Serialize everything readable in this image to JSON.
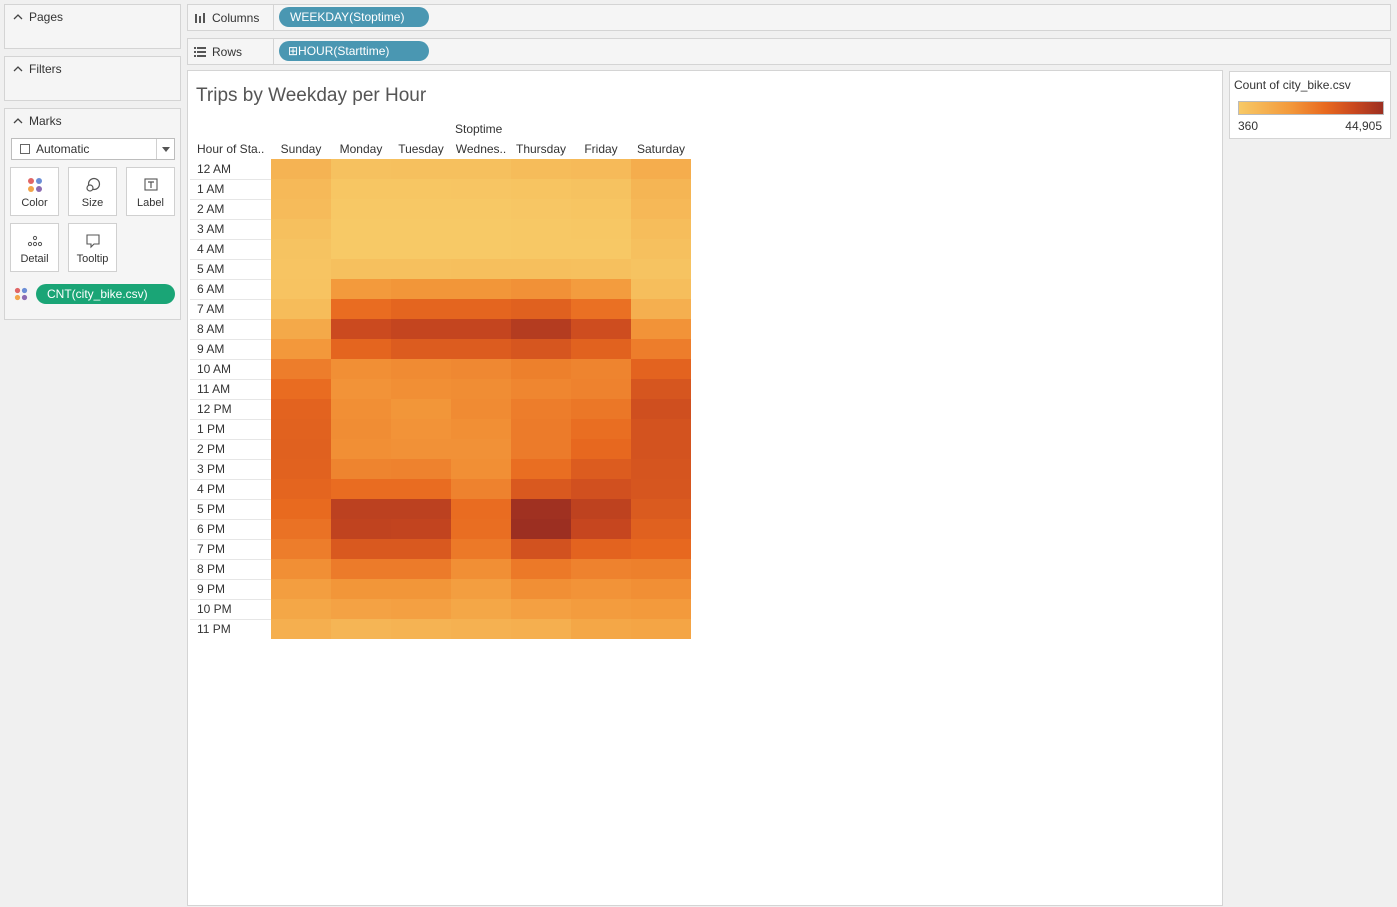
{
  "left_panel": {
    "pages_label": "Pages",
    "filters_label": "Filters",
    "marks_label": "Marks",
    "mark_type": "Automatic",
    "buttons": {
      "color": "Color",
      "size": "Size",
      "label": "Label",
      "detail": "Detail",
      "tooltip": "Tooltip"
    },
    "color_pill": "CNT(city_bike.csv)"
  },
  "shelves": {
    "columns_label": "Columns",
    "columns_pill": "WEEKDAY(Stoptime)",
    "rows_label": "Rows",
    "rows_pill": "⊞HOUR(Starttime)"
  },
  "worksheet": {
    "title": "Trips by Weekday per Hour",
    "column_field": "Stoptime",
    "row_header": "Hour of Sta..",
    "days": [
      "Sunday",
      "Monday",
      "Tuesday",
      "Wednes..",
      "Thursday",
      "Friday",
      "Saturday"
    ],
    "hours": [
      "12 AM",
      "1 AM",
      "2 AM",
      "3 AM",
      "4 AM",
      "5 AM",
      "6 AM",
      "7 AM",
      "8 AM",
      "9 AM",
      "10 AM",
      "11 AM",
      "12 PM",
      "1 PM",
      "2 PM",
      "3 PM",
      "4 PM",
      "5 PM",
      "6 PM",
      "7 PM",
      "8 PM",
      "9 PM",
      "10 PM",
      "11 PM"
    ]
  },
  "legend": {
    "title": "Count of city_bike.csv",
    "min": "360",
    "max": "44,905",
    "colors": [
      "#f7c966",
      "#f39a3c",
      "#e8691f",
      "#c9481f",
      "#9c2f21"
    ]
  },
  "colors": {
    "pill_blue": "#4a97b2",
    "pill_green": "#1aa576"
  },
  "chart_data": {
    "type": "heatmap",
    "title": "Trips by Weekday per Hour",
    "x_field": "Stoptime",
    "y_field": "Hour of Sta..",
    "x": [
      "Sunday",
      "Monday",
      "Tuesday",
      "Wednes..",
      "Thursday",
      "Friday",
      "Saturday"
    ],
    "y": [
      "12 AM",
      "1 AM",
      "2 AM",
      "3 AM",
      "4 AM",
      "5 AM",
      "6 AM",
      "7 AM",
      "8 AM",
      "9 AM",
      "10 AM",
      "11 AM",
      "12 PM",
      "1 PM",
      "2 PM",
      "3 PM",
      "4 PM",
      "5 PM",
      "6 PM",
      "7 PM",
      "8 PM",
      "9 PM",
      "10 PM",
      "11 PM"
    ],
    "color_range": [
      360,
      44905
    ],
    "values": [
      [
        5500,
        2200,
        2400,
        2600,
        3500,
        3800,
        7000
      ],
      [
        4200,
        1100,
        1100,
        1200,
        1600,
        2000,
        5200
      ],
      [
        3600,
        600,
        600,
        700,
        1000,
        1400,
        4400
      ],
      [
        2500,
        400,
        400,
        450,
        600,
        900,
        3200
      ],
      [
        1800,
        400,
        360,
        400,
        500,
        700,
        2400
      ],
      [
        1500,
        2500,
        2600,
        2700,
        2800,
        2400,
        1800
      ],
      [
        1700,
        11500,
        12500,
        12500,
        13500,
        11000,
        3000
      ],
      [
        3500,
        22000,
        24000,
        24000,
        25500,
        21000,
        6500
      ],
      [
        8000,
        33000,
        35000,
        35000,
        39000,
        32000,
        13000
      ],
      [
        12000,
        24000,
        27000,
        27000,
        29000,
        25000,
        18000
      ],
      [
        18000,
        14000,
        15000,
        15500,
        17500,
        16500,
        24500
      ],
      [
        22000,
        13000,
        14000,
        14500,
        16000,
        17000,
        29000
      ],
      [
        24500,
        14000,
        12500,
        15000,
        18000,
        19500,
        31500
      ],
      [
        25000,
        14500,
        13000,
        14000,
        18500,
        21500,
        30000
      ],
      [
        25500,
        14000,
        13500,
        13500,
        18500,
        23000,
        30000
      ],
      [
        25000,
        16500,
        17000,
        14000,
        21500,
        27000,
        29500
      ],
      [
        24000,
        22000,
        22000,
        17000,
        28000,
        31000,
        29000
      ],
      [
        22500,
        37000,
        37000,
        22000,
        44000,
        36500,
        27500
      ],
      [
        20500,
        36000,
        35500,
        21500,
        44905,
        34500,
        25500
      ],
      [
        18000,
        28000,
        28000,
        19000,
        30500,
        24500,
        23000
      ],
      [
        14000,
        18500,
        18500,
        14000,
        19000,
        17000,
        17500
      ],
      [
        10500,
        12500,
        12500,
        10500,
        14000,
        13000,
        14000
      ],
      [
        8500,
        9500,
        10000,
        8500,
        10000,
        11000,
        11500
      ],
      [
        6500,
        5000,
        5500,
        6000,
        6500,
        8500,
        9000
      ]
    ]
  }
}
